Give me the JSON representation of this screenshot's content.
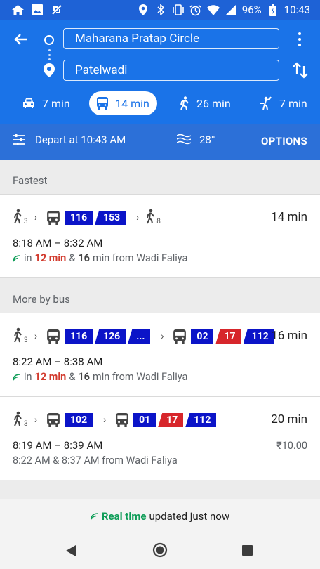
{
  "status_bar": {
    "battery": "96%",
    "time": "10:43"
  },
  "search": {
    "origin": "Maharana Pratap Circle",
    "destination": "Patelwadi"
  },
  "modes": [
    {
      "name": "car",
      "time": "7 min"
    },
    {
      "name": "transit",
      "time": "14 min"
    },
    {
      "name": "walk",
      "time": "26 min"
    },
    {
      "name": "ride",
      "time": "7 min"
    }
  ],
  "options_bar": {
    "depart": "Depart at 10:43 AM",
    "temperature": "28°",
    "options_label": "OPTIONS"
  },
  "sections": {
    "fastest": "Fastest",
    "more_by_bus": "More by bus"
  },
  "routes": [
    {
      "walk_start": "3",
      "badges1": [
        "116",
        "153"
      ],
      "walk_end": "8",
      "duration": "14 min",
      "times": "8:18 AM – 8:32 AM",
      "rt_prefix": "in",
      "rt_first": "12 min",
      "rt_amp": "&",
      "rt_second": "16",
      "rt_suffix": "min from Wadi Faliya"
    },
    {
      "walk_start": "3",
      "badges1": [
        "116",
        "126",
        "..."
      ],
      "badges2": [
        "02",
        "17",
        "112"
      ],
      "duration": "16 min",
      "times": "8:22 AM – 8:38 AM",
      "rt_prefix": "in",
      "rt_first": "12 min",
      "rt_amp": "&",
      "rt_second": "16",
      "rt_suffix": "min from Wadi Faliya"
    },
    {
      "walk_start": "3",
      "badges1": [
        "102"
      ],
      "badges2": [
        "01",
        "17",
        "112"
      ],
      "duration": "20 min",
      "times": "8:19 AM – 8:39 AM",
      "fare": "₹10.00",
      "schedule": "8:22 AM & 8:37 AM from Wadi Faliya"
    }
  ],
  "footer": {
    "realtime": "Real time",
    "updated": "updated just now"
  },
  "colors": {
    "header_blue": "#1a73e8",
    "badge_blue": "#0b14c8",
    "badge_red": "#d7262b",
    "realtime_green": "#0f9d58",
    "late_red": "#d23a2d"
  }
}
